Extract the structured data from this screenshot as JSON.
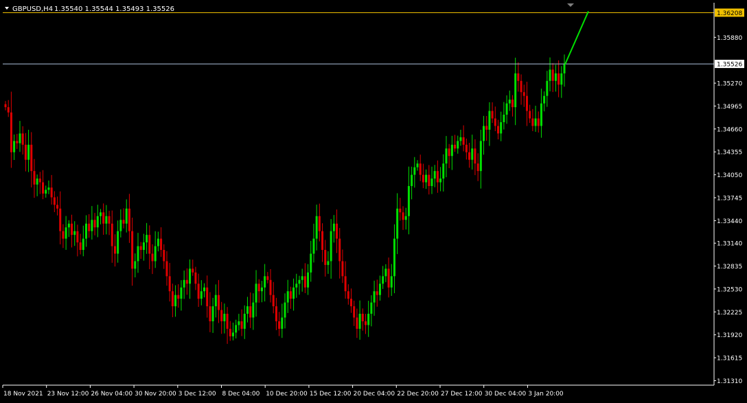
{
  "header": {
    "symbol": "GBPUSD,H4",
    "ohlc": "1.35540 1.35544 1.35493 1.35526"
  },
  "price_axis": {
    "ticks": [
      "1.35880",
      "1.35270",
      "1.34965",
      "1.34660",
      "1.34355",
      "1.34050",
      "1.33745",
      "1.33440",
      "1.33140",
      "1.32835",
      "1.32530",
      "1.32225",
      "1.31920",
      "1.31615",
      "1.31310"
    ],
    "levels": [
      {
        "label": "1.36208",
        "price": 1.36208,
        "color": "#f0c000",
        "role": "horizontal-line"
      },
      {
        "label": "1.35526",
        "price": 1.35526,
        "color": "#b0c4de",
        "role": "bid-line"
      }
    ]
  },
  "time_axis": {
    "labels": [
      "18 Nov 2021",
      "23 Nov 12:00",
      "26 Nov 04:00",
      "30 Nov 20:00",
      "3 Dec 12:00",
      "8 Dec 04:00",
      "10 Dec 20:00",
      "15 Dec 12:00",
      "20 Dec 04:00",
      "22 Dec 20:00",
      "27 Dec 12:00",
      "30 Dec 04:00",
      "3 Jan 20:00"
    ]
  },
  "colors": {
    "background": "#000000",
    "bull": "#00e000",
    "bear": "#e00000",
    "axis": "#ffffff",
    "text": "#ffffff",
    "trendline": "#00e000"
  },
  "chart_data": {
    "type": "candlestick",
    "title": "GBPUSD,H4",
    "ylim": [
      1.3125,
      1.3634
    ],
    "series": [
      {
        "closes": [
          1.3495,
          1.3488,
          1.3435,
          1.345,
          1.3447,
          1.346,
          1.3445,
          1.3425,
          1.3445,
          1.341,
          1.3392,
          1.34,
          1.3395,
          1.338,
          1.3385,
          1.3388,
          1.3375,
          1.3365,
          1.336,
          1.333,
          1.332,
          1.3335,
          1.334,
          1.3325,
          1.333,
          1.3315,
          1.3305,
          1.332,
          1.334,
          1.333,
          1.3345,
          1.3335,
          1.335,
          1.3355,
          1.334,
          1.335,
          1.334,
          1.331,
          1.33,
          1.333,
          1.3345,
          1.334,
          1.336,
          1.333,
          1.328,
          1.329,
          1.331,
          1.3305,
          1.3315,
          1.3325,
          1.33,
          1.329,
          1.331,
          1.332,
          1.3305,
          1.329,
          1.327,
          1.325,
          1.323,
          1.3245,
          1.324,
          1.3255,
          1.3265,
          1.326,
          1.328,
          1.3275,
          1.326,
          1.324,
          1.325,
          1.3255,
          1.323,
          1.321,
          1.323,
          1.3245,
          1.3225,
          1.321,
          1.322,
          1.32,
          1.319,
          1.3195,
          1.3205,
          1.321,
          1.32,
          1.322,
          1.323,
          1.3215,
          1.3235,
          1.326,
          1.325,
          1.3255,
          1.327,
          1.3265,
          1.3245,
          1.323,
          1.321,
          1.32,
          1.3215,
          1.3235,
          1.325,
          1.324,
          1.3255,
          1.326,
          1.3265,
          1.327,
          1.3255,
          1.3275,
          1.33,
          1.332,
          1.335,
          1.333,
          1.3305,
          1.3285,
          1.329,
          1.333,
          1.334,
          1.332,
          1.329,
          1.327,
          1.325,
          1.324,
          1.323,
          1.3215,
          1.32,
          1.322,
          1.321,
          1.3205,
          1.322,
          1.3235,
          1.325,
          1.3245,
          1.326,
          1.327,
          1.328,
          1.3255,
          1.327,
          1.332,
          1.336,
          1.3355,
          1.3345,
          1.335,
          1.339,
          1.3405,
          1.3415,
          1.342,
          1.3405,
          1.3395,
          1.3405,
          1.339,
          1.34,
          1.341,
          1.3395,
          1.34,
          1.342,
          1.344,
          1.343,
          1.3445,
          1.344,
          1.345,
          1.3455,
          1.3445,
          1.3435,
          1.3425,
          1.344,
          1.342,
          1.341,
          1.345,
          1.347,
          1.3465,
          1.349,
          1.348,
          1.347,
          1.346,
          1.3475,
          1.3485,
          1.35,
          1.3505,
          1.3495,
          1.354,
          1.353,
          1.3515,
          1.351,
          1.349,
          1.348,
          1.347,
          1.348,
          1.347,
          1.35,
          1.351,
          1.353,
          1.3545,
          1.353,
          1.354,
          1.3525,
          1.354,
          1.3552
        ]
      }
    ]
  }
}
